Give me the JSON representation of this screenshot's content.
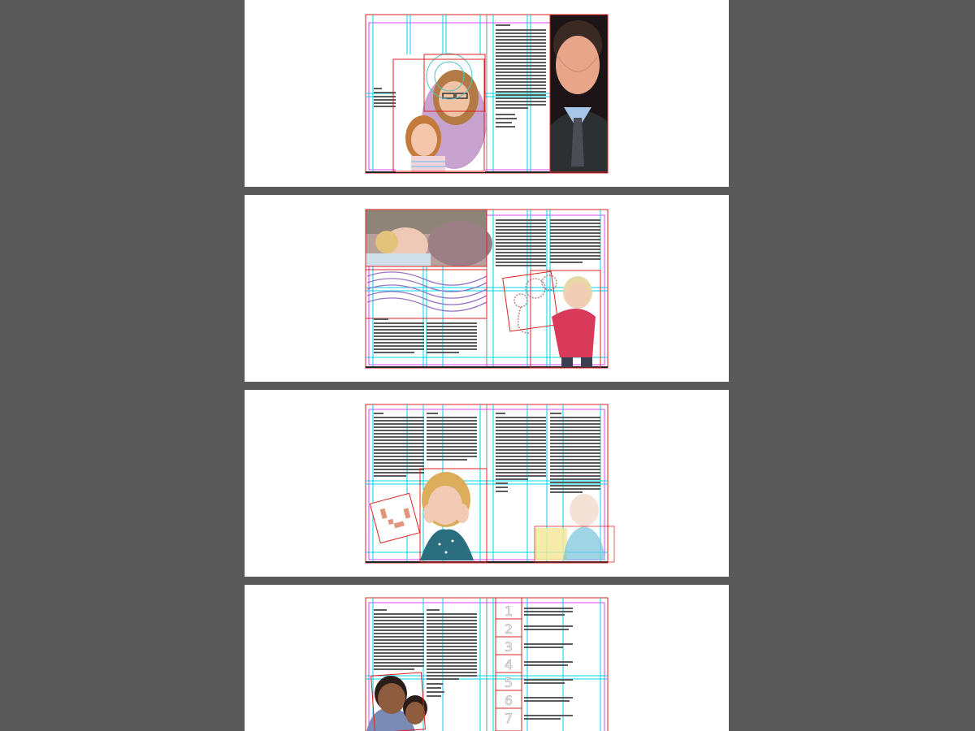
{
  "app": {
    "background_color": "#595959",
    "page_color": "#ffffff",
    "guide_colors": {
      "column": "#00d5e6",
      "margin": "#e040ff",
      "bleed": "#e02020",
      "text": "#5a5a5a"
    }
  },
  "spreads": [
    {
      "name": "spread-1",
      "photos": [
        "mother-and-daughter-photo",
        "man-in-suit-portrait"
      ]
    },
    {
      "name": "spread-2",
      "photos": [
        "sleeping-newborn-photo",
        "toddler-with-stethoscope-photo"
      ]
    },
    {
      "name": "spread-3",
      "photos": [
        "girl-hands-on-cheeks-photo",
        "boy-in-blue-shirt-photo"
      ]
    },
    {
      "name": "spread-4",
      "photos": [
        "two-boys-smiling-photo"
      ],
      "steps_sidebar": [
        "1",
        "2",
        "3",
        "4",
        "5",
        "6",
        "7"
      ]
    }
  ]
}
